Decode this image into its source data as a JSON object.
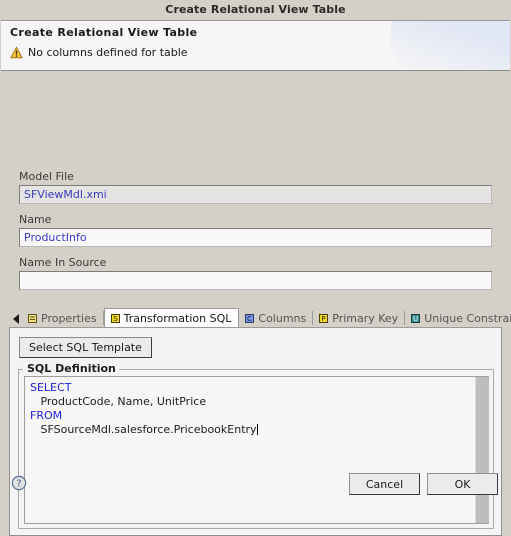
{
  "window": {
    "title": "Create Relational View Table"
  },
  "header": {
    "title": "Create Relational View Table",
    "message": "No columns defined for table",
    "message_icon": "warning-triangle-icon"
  },
  "form": {
    "model_file": {
      "label": "Model File",
      "value": "SFViewMdl.xmi",
      "placeholder": ""
    },
    "name": {
      "label": "Name",
      "value": "ProductInfo",
      "placeholder": ""
    },
    "name_in_source": {
      "label": "Name In Source",
      "value": "",
      "placeholder": ""
    }
  },
  "tabs": {
    "scroll_left_label": "◀",
    "scroll_right_label": "▶",
    "items": [
      {
        "label": "Properties",
        "icon": "properties-icon",
        "active": false
      },
      {
        "label": "Transformation SQL",
        "icon": "transformation-sql-icon",
        "active": true
      },
      {
        "label": "Columns",
        "icon": "columns-icon",
        "active": false
      },
      {
        "label": "Primary Key",
        "icon": "primary-key-icon",
        "active": false
      },
      {
        "label": "Unique Constraint",
        "icon": "unique-constraint-icon",
        "active": false
      }
    ]
  },
  "transformation_sql": {
    "template_button": "Select SQL Template",
    "group_label": "SQL Definition",
    "sql_lines": [
      {
        "keyword": "SELECT",
        "body": ""
      },
      {
        "keyword": "",
        "body": "   ProductCode, Name, UnitPrice"
      },
      {
        "keyword": "FROM",
        "body": ""
      },
      {
        "keyword": "",
        "body": "   SFSourceMdl.salesforce.PricebookEntry"
      }
    ],
    "sql_text": "SELECT\n   ProductCode, Name, UnitPrice\nFROM\n   SFSourceMdl.salesforce.PricebookEntry"
  },
  "footer": {
    "help_icon": "help-question-icon",
    "cancel_label": "Cancel",
    "ok_label": "OK"
  },
  "colors": {
    "dialog_background": "#d4d0c8",
    "header_background": "#f6f6f6",
    "input_text": "#3b3bbf",
    "sql_keyword": "#2020e0",
    "warning": "#f0ad22",
    "tab_active_background": "#fdfdfd"
  }
}
